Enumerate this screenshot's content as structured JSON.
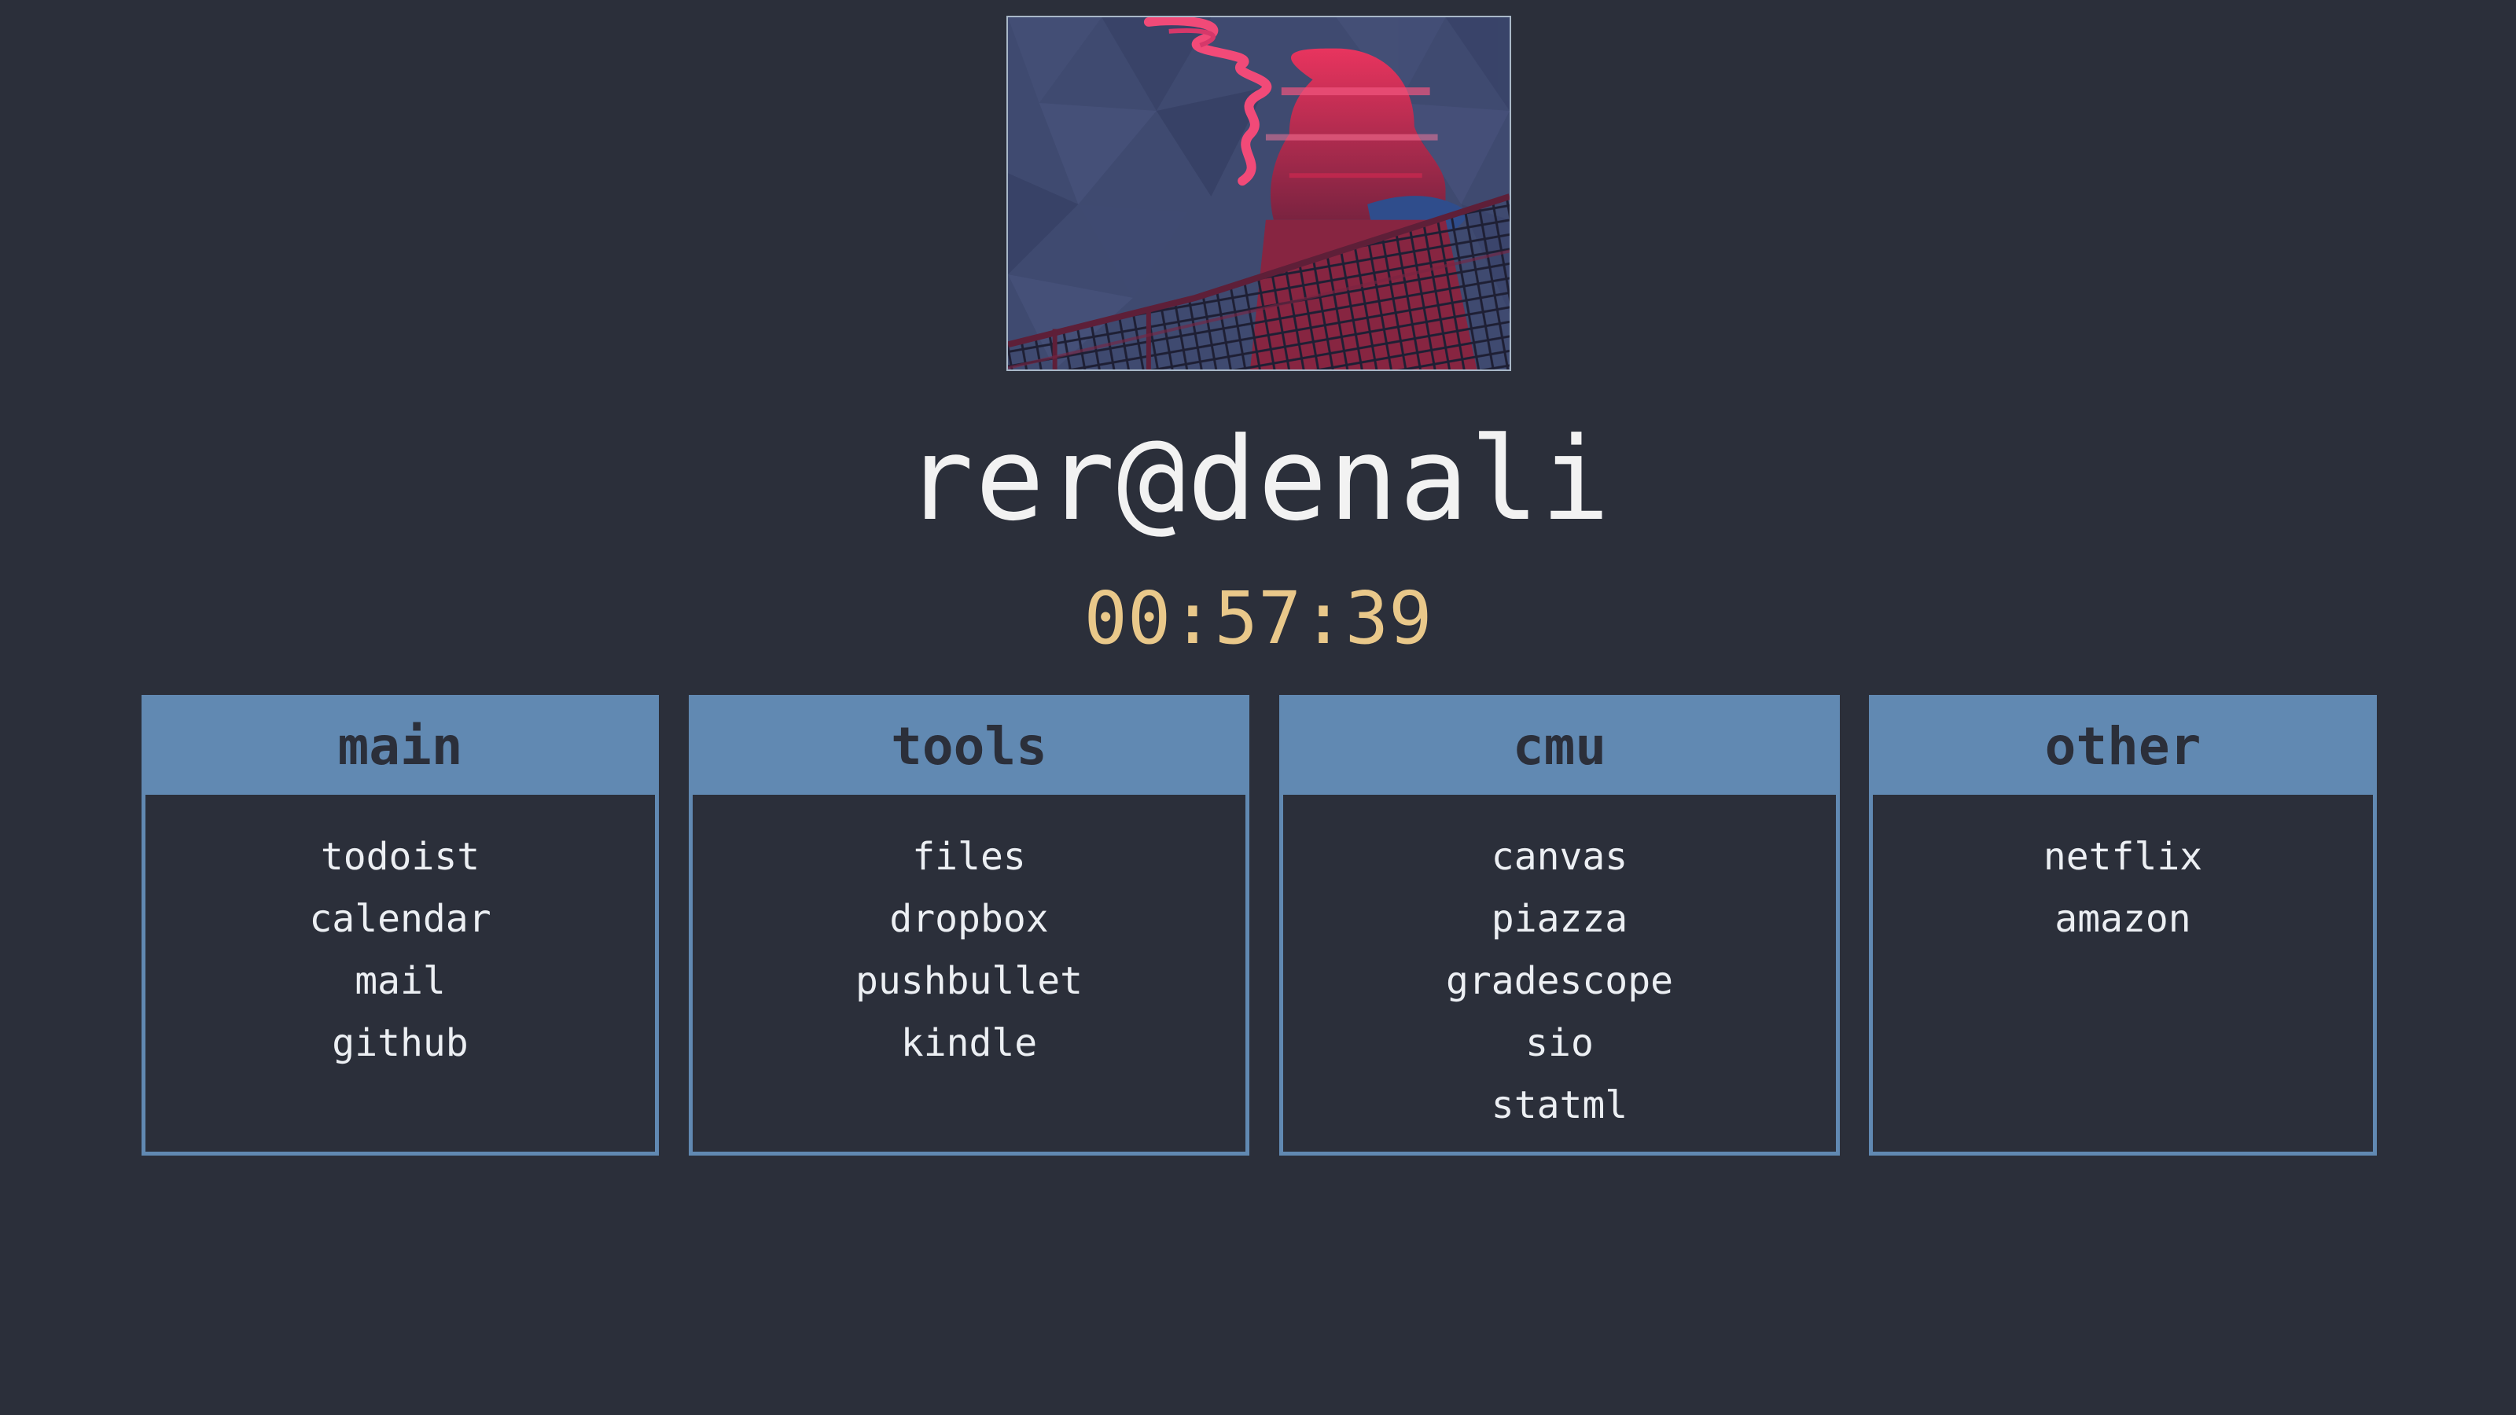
{
  "header": {
    "hostname": "rer@denali",
    "clock": "00:57:39"
  },
  "banner": {
    "icon": "glitch-art-image"
  },
  "colors": {
    "background": "#2b2f3a",
    "accent": "#6189b2",
    "clock": "#e9c88a",
    "text": "#eceff3"
  },
  "panels": [
    {
      "title": "main",
      "links": [
        "todoist",
        "calendar",
        "mail",
        "github"
      ]
    },
    {
      "title": "tools",
      "links": [
        "files",
        "dropbox",
        "pushbullet",
        "kindle"
      ]
    },
    {
      "title": "cmu",
      "links": [
        "canvas",
        "piazza",
        "gradescope",
        "sio",
        "statml"
      ]
    },
    {
      "title": "other",
      "links": [
        "netflix",
        "amazon"
      ]
    }
  ]
}
